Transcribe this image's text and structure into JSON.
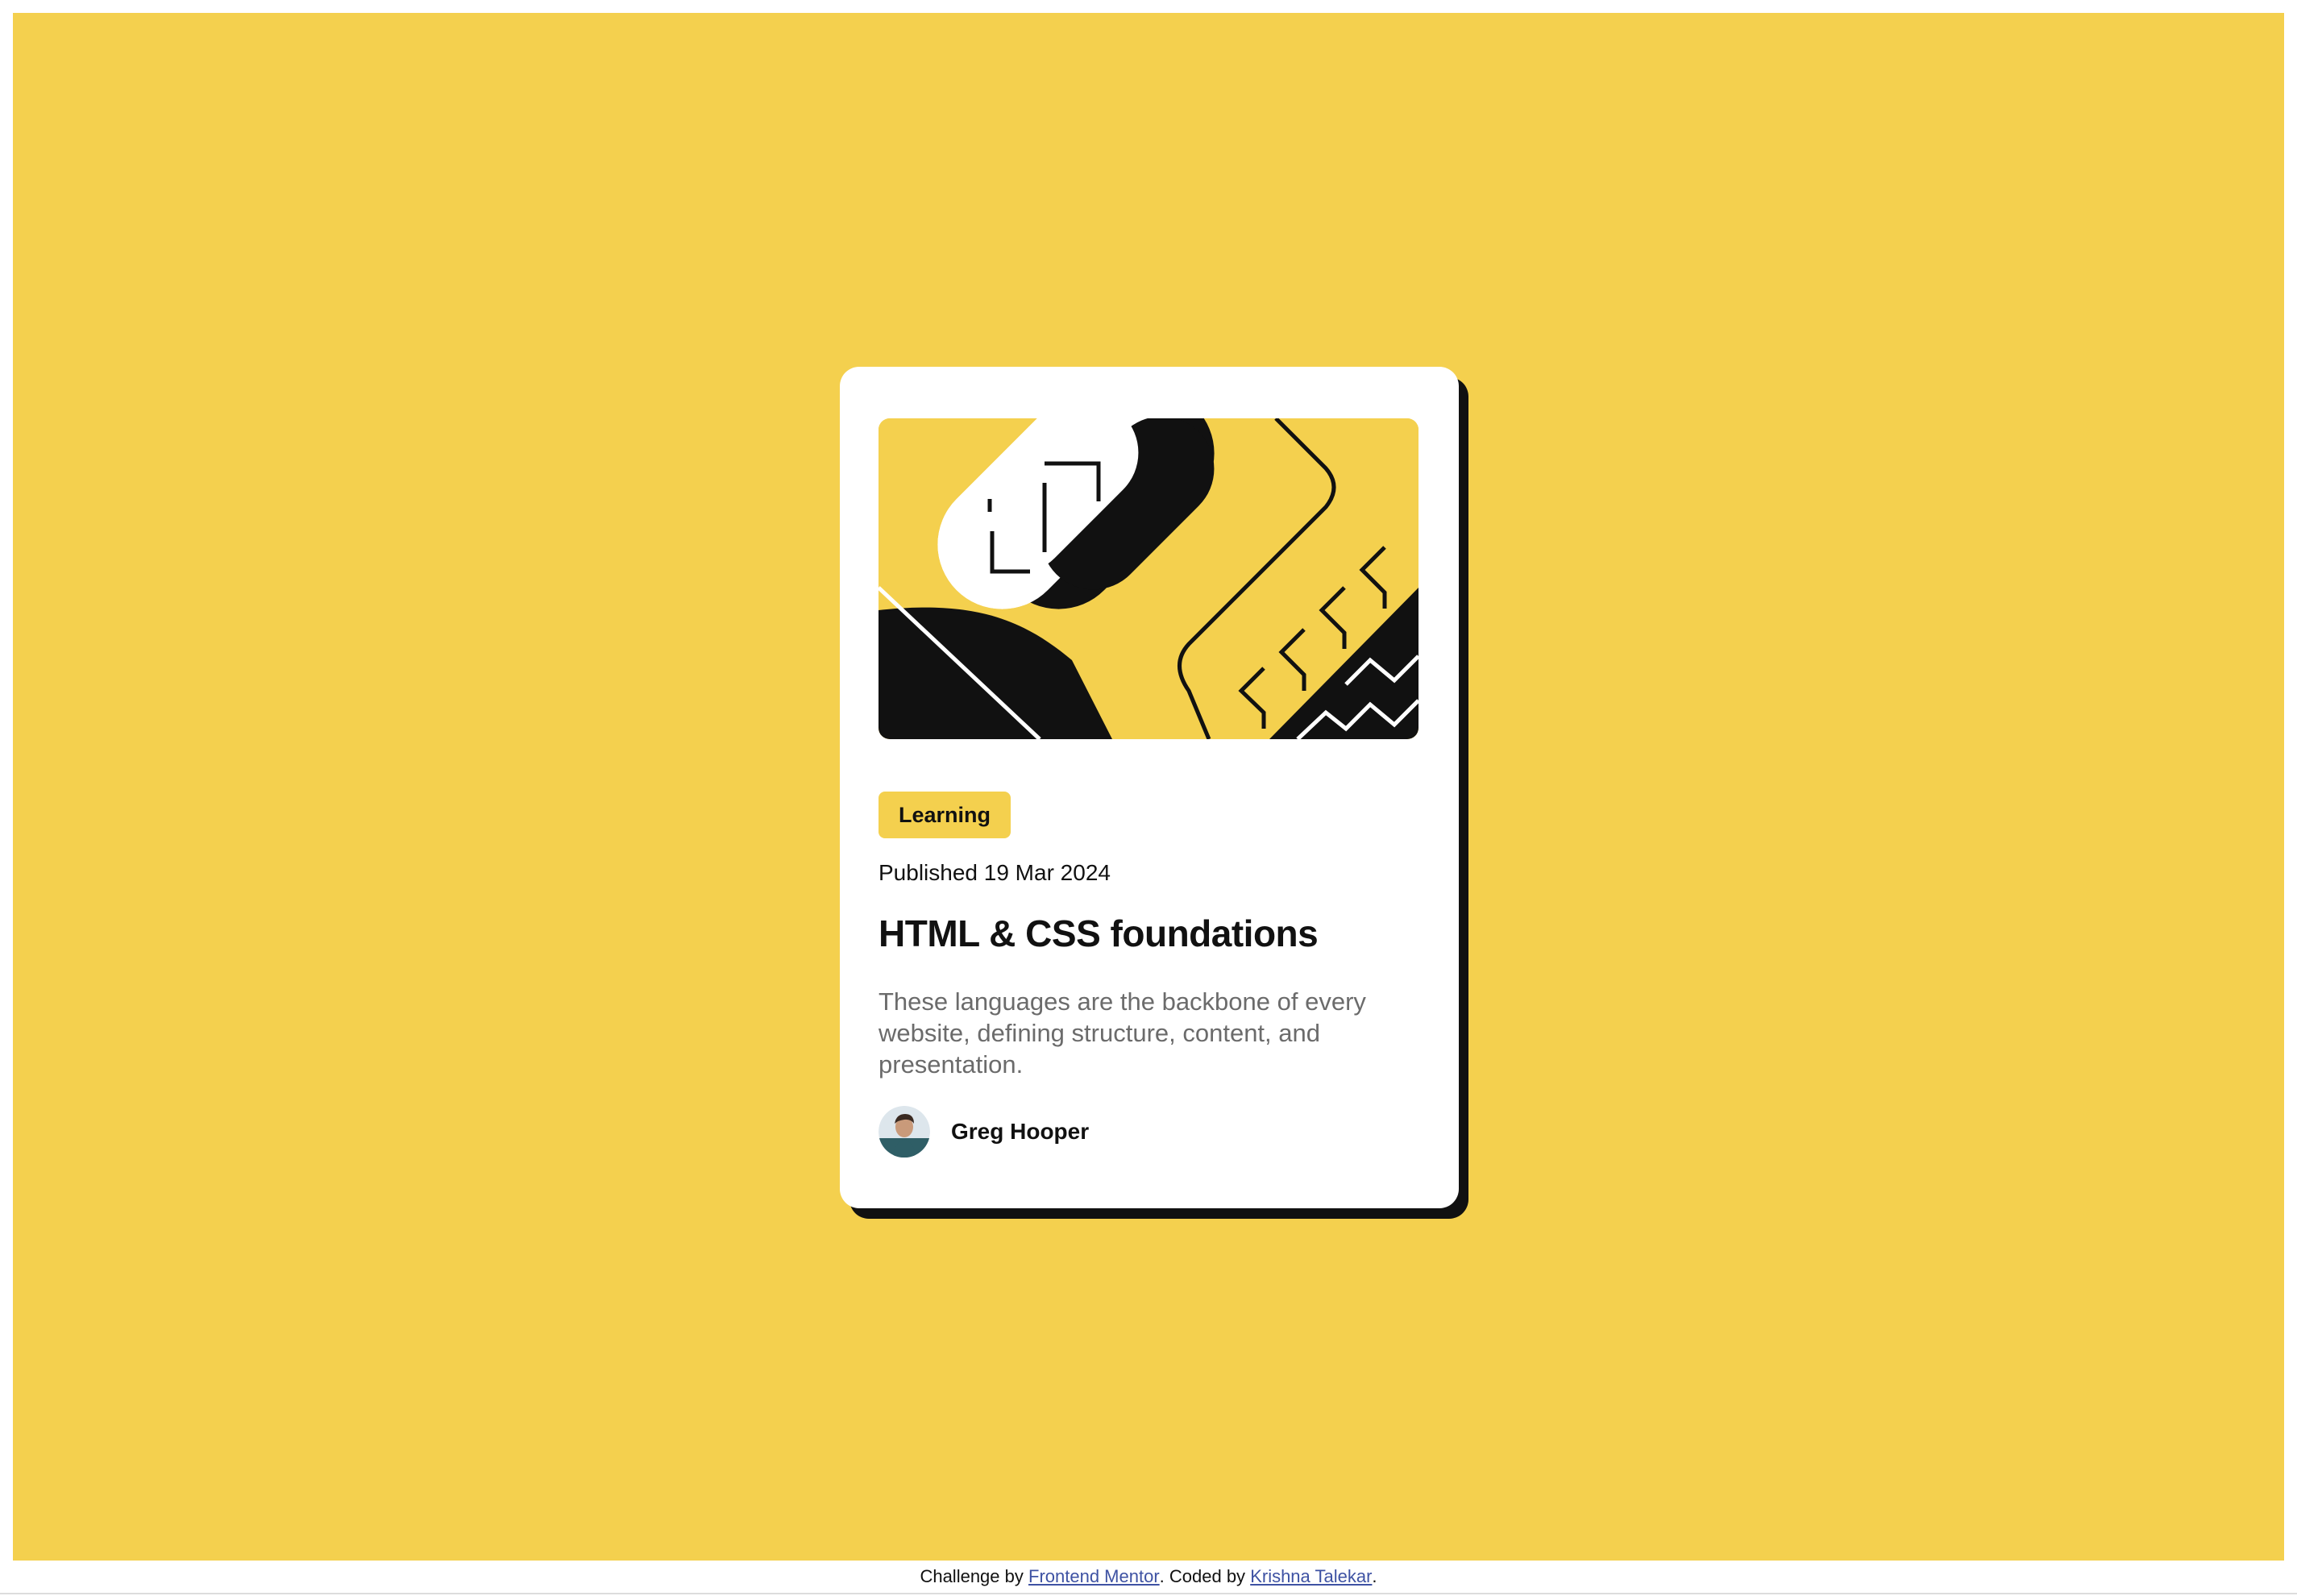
{
  "colors": {
    "background": "#F4D04E",
    "card": "#FFFFFF",
    "shadow": "#111111",
    "text_dark": "#111111",
    "text_muted": "#6B6B6B",
    "link": "#3E52A3"
  },
  "card": {
    "hero_image": "blog-illustration",
    "tag": "Learning",
    "published": "Published 19 Mar 2024",
    "title": "HTML & CSS foundations",
    "description": "These languages are the backbone of every website, defining structure, content, and presentation.",
    "author": {
      "avatar": "avatar-image",
      "name": "Greg Hooper"
    }
  },
  "footer": {
    "prefix": "Challenge by ",
    "link1": "Frontend Mentor",
    "middle": ". Coded by ",
    "link2": "Krishna Talekar",
    "suffix": "."
  }
}
